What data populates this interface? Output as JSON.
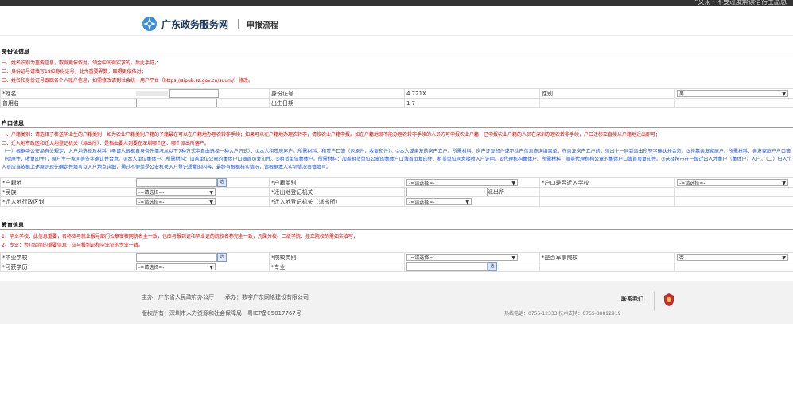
{
  "topbar": {
    "right_text": "“又来 · 不要过度解读信行主品总"
  },
  "header": {
    "site_name": "广东政务服务网",
    "breadcrumb": "申报流程",
    "brand_color": "#1f3a60"
  },
  "id_section": {
    "title": "身份证信息",
    "notes": [
      "一、姓名识别为重要信息，取得更依依对，领金中间得实求的，后此手符，：",
      "二、身份证号请填写18位身份证号，此为重要界数，取得更依依对；",
      "三、姓名和身份证号跟踪各个人账户信息，如需修改请到社会统一用户平台（https://sipub.sz.gov.cn/suum/）修改。"
    ],
    "name_label": "*姓名",
    "id_label": "身份证号",
    "id_value": "4              721X",
    "gender_label": "性别",
    "gender_value": "男",
    "former_name_label": "曾用名",
    "birth_label": "出生日期",
    "birth_value": "1        7"
  },
  "hukou_section": {
    "title": "户口信息",
    "notes": [
      "一、户籍类别：请选择了移送毕业生的户籍类别，如为农业户籍类别户籍的了籍最在可以在户籍地办理农转非手续；如果可以在户籍地办理农转非，请按农业户籍申报。如在户籍地既不能办理农转非手续的人员方可申报农业户籍，已申报农业户籍的人员在深圳办理农转非手续，户口迁移立直接从户籍地迁出即可；",
      "二、迁入地市政区和迁入地登记机关（派出所）：是指由要人到要在深圳哪个区、哪个派出所落户。",
      "（一）根据中公安局有关规定，入户地选择及材料（申请人根据自身条件情况从以下7种方式中自由选择一种入户方式）：①本人租赁房屋户。所需材料：租赁户口簿（包原件，收复印件）。②本人或亲友的房产立户。所需材料：房产证复印件或不动产信息查询结果单。在亲友房产立户的，须出生一同到派出所签字确认并合意。③挂靠亲友家庭户。所需材料：亲友家庭户户口簿（验原件，收复印件），原户主一家同等签字确认并合意。④本人单位集体户。所需材料：加盖单位公章的集体户口簿首页复印件。⑤租赁单位集体户。所需材料：加盖租赁单位公章的集体户口簿首页复印件、租赁单位同意接收入户证明。⑥代理机构集体户。所需材料：加盖代理机构公章的集体户口簿首页复印件。⑦选择按市在一级迁出入才集户（集体户）入户。（二）扫入个人员应当依据上述原则现先确定并填写以入户地点详细，通过不便单是公安机关入户登记质量的内容，最终有根据核实情况，请根据本人实际情况审慎填写。"
    ],
    "hukou_place_label": "*户籍地",
    "hukou_type_label": "*户籍类别",
    "hukou_type_value": "-=请选择=-",
    "is_school_label": "*户口是否迁入学校",
    "is_school_value": "-=请选择=-",
    "ethnicity_label": "*民族",
    "ethnicity_value": "-=请选择=-",
    "moveout_office_label": "*迁出地登记机关",
    "police_suffix": "派出所",
    "district_label": "*迁入地行政区划",
    "district_value": "-=请选择=-",
    "movein_office_label": "*迁入地登记机关（派出所）",
    "movein_office_value": "-=请选择=-"
  },
  "edu_section": {
    "title": "教育信息",
    "notes": [
      "1、毕业学校：此信息重要，名称应与就业报导部门公章审核网统名全一致，也应与报到证和毕业证的院校名称完全一致，凡属分校、二级学院、挂立院校的需如实填写；",
      "2、专业：为介绍简的重要信息，应与报到证和毕业证的专业一致。"
    ],
    "school_label": "*毕业学校",
    "school_type_label": "*院校类别",
    "school_type_value": "-=请选择=-",
    "military_label": "*是否军事院校",
    "military_value": "否",
    "degree_label": "*可获学历",
    "degree_value": "-=请选择=-",
    "major_label": "*专业"
  },
  "footer": {
    "host": "主办：广东省人民政府办公厅　　承办：数字广东网络建设有限公司",
    "copyright": "版权所有：深圳市人力资源和社会保障局　粤ICP备05017767号",
    "contact_title": "联系我们",
    "tel": "热线电话：0755-12333  技术支持：0755-88892919"
  }
}
